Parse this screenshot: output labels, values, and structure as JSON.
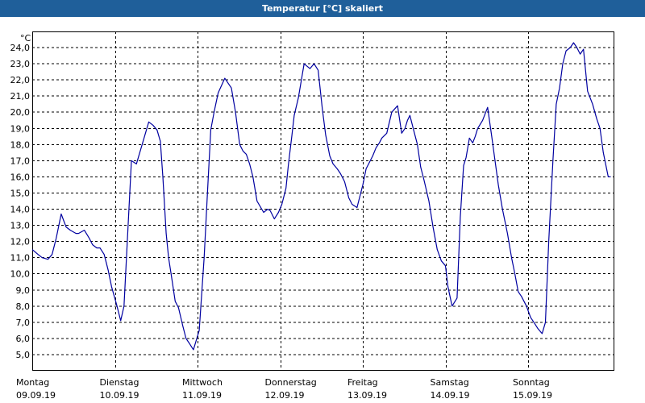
{
  "title": "Temperatur [°C] skaliert",
  "colors": {
    "title_bar": "#1f5f9a",
    "title_text": "#ffffff",
    "line": "#0000a0",
    "grid": "#000000",
    "frame": "#000000"
  },
  "chart_data": {
    "type": "line",
    "ylabel": "°C",
    "ylim": [
      4.0,
      25.0
    ],
    "y_ticks": [
      "5,0",
      "6,0",
      "7,0",
      "8,0",
      "9,0",
      "10,0",
      "11,0",
      "12,0",
      "13,0",
      "14,0",
      "15,0",
      "16,0",
      "17,0",
      "18,0",
      "19,0",
      "20,0",
      "21,0",
      "22,0",
      "23,0",
      "24,0"
    ],
    "grid": true,
    "grid_style": "dashed",
    "xlim": [
      0,
      7
    ],
    "day_labels": [
      {
        "day": "Montag",
        "date": "09.09.19"
      },
      {
        "day": "Dienstag",
        "date": "10.09.19"
      },
      {
        "day": "Mittwoch",
        "date": "11.09.19"
      },
      {
        "day": "Donnerstag",
        "date": "12.09.19"
      },
      {
        "day": "Freitag",
        "date": "13.09.19"
      },
      {
        "day": "Samstag",
        "date": "14.09.19"
      },
      {
        "day": "Sonntag",
        "date": "15.09.19"
      }
    ],
    "series": [
      {
        "x": [
          0.0,
          0.07,
          0.12,
          0.19,
          0.24,
          0.29,
          0.35,
          0.41,
          0.46,
          0.53,
          0.56,
          0.63,
          0.69,
          0.73,
          0.78,
          0.82,
          0.87,
          0.92,
          0.96,
          1.02,
          1.07,
          1.11,
          1.16,
          1.2,
          1.26,
          1.33,
          1.37,
          1.41,
          1.46,
          1.51,
          1.55,
          1.58,
          1.62,
          1.65,
          1.68,
          1.73,
          1.77,
          1.82,
          1.86,
          1.9,
          1.95,
          2.02,
          2.08,
          2.12,
          2.16,
          2.2,
          2.25,
          2.33,
          2.41,
          2.46,
          2.51,
          2.55,
          2.59,
          2.63,
          2.67,
          2.72,
          2.8,
          2.85,
          2.88,
          2.93,
          2.98,
          3.02,
          3.07,
          3.1,
          3.14,
          3.17,
          3.22,
          3.29,
          3.36,
          3.41,
          3.46,
          3.51,
          3.55,
          3.6,
          3.64,
          3.69,
          3.73,
          3.78,
          3.83,
          3.87,
          3.93,
          4.0,
          4.04,
          4.07,
          4.12,
          4.16,
          4.2,
          4.23,
          4.29,
          4.35,
          4.42,
          4.47,
          4.51,
          4.54,
          4.57,
          4.61,
          4.66,
          4.7,
          4.74,
          4.8,
          4.85,
          4.9,
          4.95,
          5.0,
          5.03,
          5.08,
          5.14,
          5.18,
          5.22,
          5.25,
          5.29,
          5.33,
          5.36,
          5.39,
          5.45,
          5.51,
          5.56,
          5.6,
          5.64,
          5.69,
          5.75,
          5.8,
          5.84,
          5.88,
          5.92,
          5.98,
          6.03,
          6.07,
          6.12,
          6.17,
          6.21,
          6.25,
          6.3,
          6.34,
          6.38,
          6.42,
          6.46,
          6.51,
          6.55,
          6.59,
          6.63,
          6.67,
          6.72,
          6.78,
          6.83,
          6.87,
          6.91,
          6.97,
          7.0
        ],
        "values": [
          11.5,
          11.2,
          11.0,
          10.9,
          11.2,
          12.2,
          13.7,
          12.9,
          12.7,
          12.5,
          12.5,
          12.7,
          12.2,
          11.8,
          11.6,
          11.6,
          11.2,
          10.2,
          9.2,
          8.1,
          7.1,
          8.0,
          13.0,
          17.0,
          16.8,
          18.0,
          18.7,
          19.4,
          19.2,
          18.9,
          18.2,
          16.0,
          12.5,
          11.0,
          10.0,
          8.3,
          7.9,
          6.8,
          6.0,
          5.7,
          5.3,
          6.5,
          11.0,
          15.0,
          18.9,
          20.0,
          21.2,
          22.1,
          21.5,
          20.0,
          18.0,
          17.6,
          17.4,
          16.8,
          16.0,
          14.5,
          13.8,
          14.0,
          13.9,
          13.4,
          13.8,
          14.3,
          15.3,
          16.8,
          18.5,
          19.8,
          20.9,
          23.0,
          22.7,
          23.0,
          22.6,
          20.2,
          18.6,
          17.3,
          16.8,
          16.5,
          16.2,
          15.7,
          14.7,
          14.3,
          14.1,
          15.5,
          16.5,
          16.8,
          17.3,
          17.8,
          18.1,
          18.4,
          18.7,
          20.0,
          20.4,
          18.7,
          19.0,
          19.5,
          19.8,
          19.0,
          18.0,
          16.6,
          15.8,
          14.5,
          12.9,
          11.5,
          10.8,
          10.5,
          9.2,
          8.0,
          8.5,
          13.5,
          16.7,
          17.2,
          18.4,
          18.1,
          18.5,
          19.0,
          19.5,
          20.3,
          18.5,
          17.0,
          15.5,
          14.0,
          12.5,
          11.0,
          10.0,
          8.9,
          8.6,
          8.0,
          7.3,
          7.0,
          6.6,
          6.3,
          7.0,
          12.0,
          17.0,
          20.5,
          21.5,
          23.0,
          23.8,
          24.0,
          24.3,
          24.0,
          23.6,
          23.9,
          21.3,
          20.5,
          19.6,
          19.0,
          17.5,
          16.0,
          16.0
        ]
      }
    ]
  }
}
